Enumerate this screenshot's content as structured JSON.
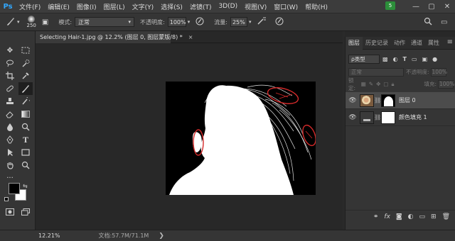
{
  "app": {
    "logo": "Ps",
    "notification_count": "5"
  },
  "menu": [
    "文件(F)",
    "编辑(E)",
    "图像(I)",
    "图层(L)",
    "文字(Y)",
    "选择(S)",
    "滤镜(T)",
    "3D(D)",
    "视图(V)",
    "窗口(W)",
    "帮助(H)"
  ],
  "window_controls": [
    "—",
    "▢",
    "✕"
  ],
  "options": {
    "brush_size": "250",
    "mode_label": "模式:",
    "mode_value": "正常",
    "opacity_label": "不透明度:",
    "opacity_value": "100%",
    "flow_label": "流量:",
    "flow_value": "25%"
  },
  "document_tab": {
    "title": "Selecting Hair-1.jpg @ 12.2% (图层 0, 图层蒙版/8) *",
    "close": "×"
  },
  "status": {
    "zoom": "12.21%",
    "doc_size": "文档:57.7M/71.1M",
    "arrow": "❯"
  },
  "panel": {
    "tabs": [
      "图层",
      "历史记录",
      "动作",
      "通道",
      "属性"
    ],
    "active_tab": 0,
    "filter_kind": "ρ类型",
    "blend_mode": "正常",
    "opacity_label": "不透明度:",
    "opacity_value": "100%",
    "lock_label": "锁定:",
    "fill_label": "填充:",
    "fill_value": "100%",
    "layers": [
      {
        "name": "图层 0",
        "selected": true
      },
      {
        "name": "颜色填充 1",
        "selected": false
      }
    ]
  },
  "colors": {
    "accent": "#31a8ff",
    "annotation": "#d42a2a",
    "selection": "#4c4c4c"
  }
}
